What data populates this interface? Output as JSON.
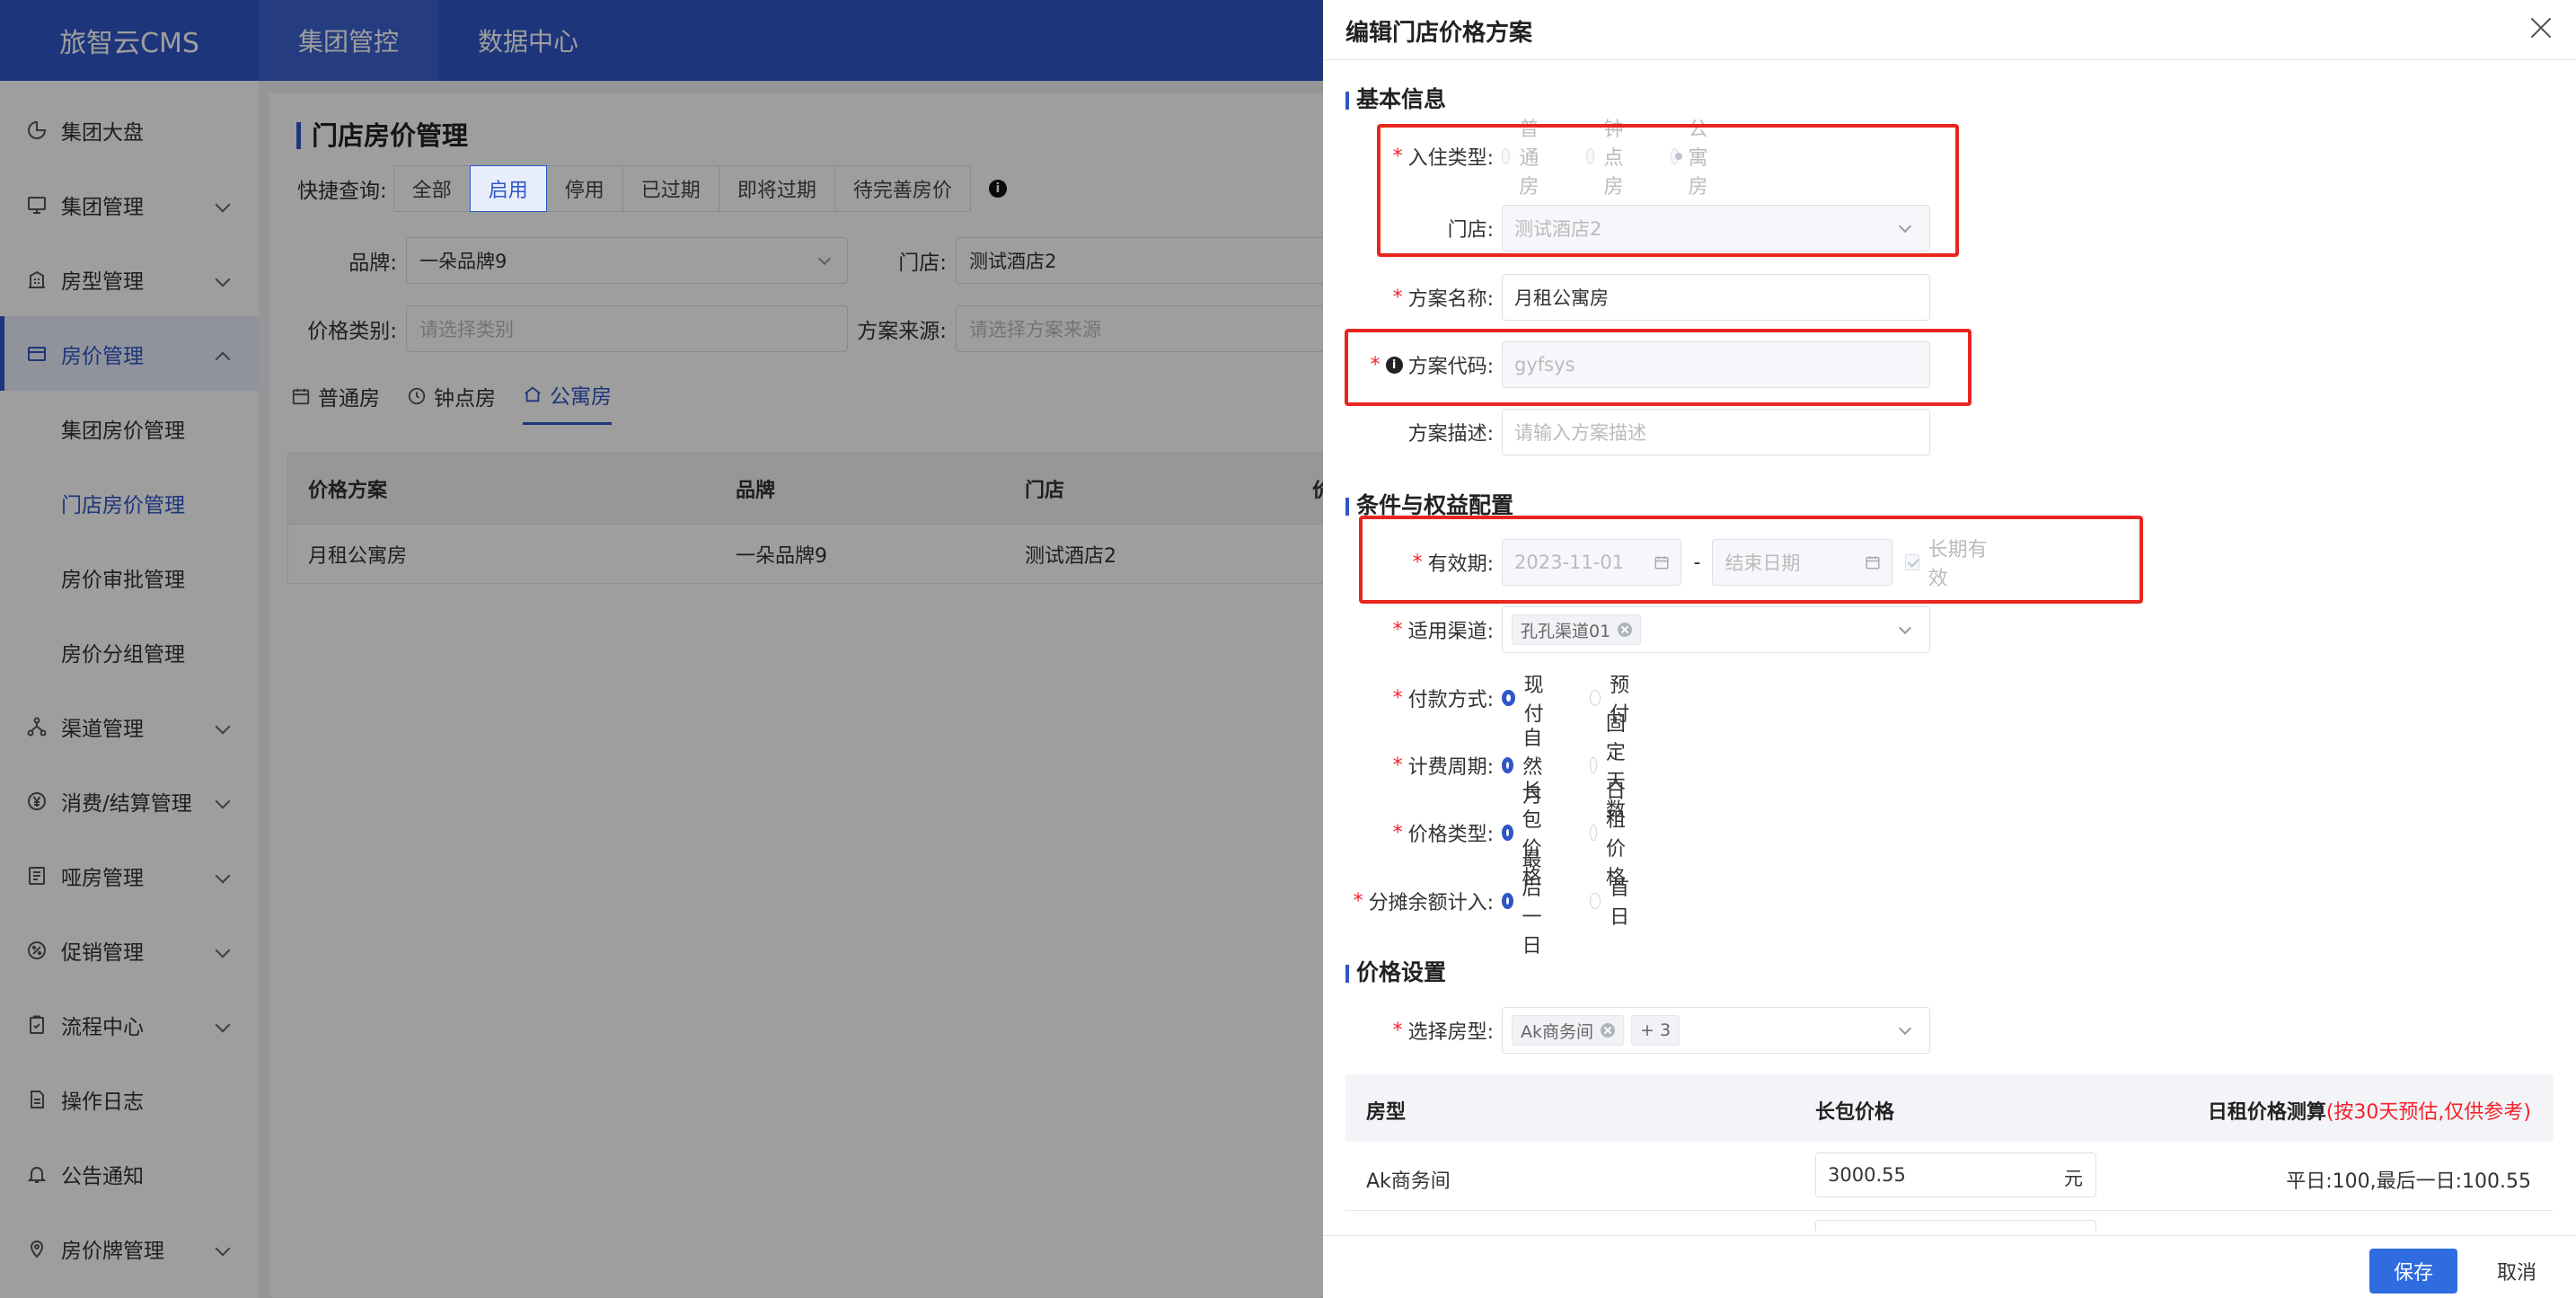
{
  "app": {
    "logo": "旅智云CMS"
  },
  "topnav": [
    "集团管控",
    "数据中心"
  ],
  "sidebar": {
    "items": [
      {
        "label": "集团大盘"
      },
      {
        "label": "集团管理"
      },
      {
        "label": "房型管理"
      },
      {
        "label": "房价管理"
      },
      {
        "label": "集团房价管理"
      },
      {
        "label": "门店房价管理"
      },
      {
        "label": "房价审批管理"
      },
      {
        "label": "房价分组管理"
      },
      {
        "label": "渠道管理"
      },
      {
        "label": "消费/结算管理"
      },
      {
        "label": "哑房管理"
      },
      {
        "label": "促销管理"
      },
      {
        "label": "流程中心"
      },
      {
        "label": "操作日志"
      },
      {
        "label": "公告通知"
      },
      {
        "label": "房价牌管理"
      }
    ]
  },
  "main": {
    "title": "门店房价管理",
    "quick_label": "快捷查询:",
    "quick": [
      "全部",
      "启用",
      "停用",
      "已过期",
      "即将过期",
      "待完善房价"
    ],
    "brand_label": "品牌:",
    "brand_value": "一朵品牌9",
    "store_label": "门店:",
    "store_value": "测试酒店2",
    "price_type_label": "价格类别:",
    "price_type_placeholder": "请选择类别",
    "source_label": "方案来源:",
    "source_placeholder": "请选择方案来源",
    "tabs": [
      "普通房",
      "钟点房",
      "公寓房"
    ],
    "table": {
      "headers": [
        "价格方案",
        "品牌",
        "门店",
        "价"
      ],
      "rows": [
        [
          "月租公寓房",
          "一朵品牌9",
          "测试酒店2"
        ]
      ]
    }
  },
  "drawer": {
    "title": "编辑门店价格方案",
    "sections": {
      "basic": "基本信息",
      "conditions": "条件与权益配置",
      "price": "价格设置"
    },
    "stay_type": {
      "label": "入住类型:",
      "options": [
        "普通房",
        "钟点房",
        "公寓房"
      ]
    },
    "store": {
      "label": "门店:",
      "value": "测试酒店2"
    },
    "plan_name": {
      "label": "方案名称:",
      "value": "月租公寓房"
    },
    "plan_code": {
      "label": "方案代码:",
      "value": "gyfsys"
    },
    "plan_desc": {
      "label": "方案描述:",
      "placeholder": "请输入方案描述"
    },
    "validity": {
      "label": "有效期:",
      "start": "2023-11-01",
      "dash": "-",
      "end_placeholder": "结束日期",
      "long_term": "长期有效"
    },
    "channel": {
      "label": "适用渠道:",
      "tag": "孔孔渠道01"
    },
    "payment": {
      "label": "付款方式:",
      "options": [
        "现付",
        "预付"
      ]
    },
    "billing": {
      "label": "计费周期:",
      "options": [
        "自然月",
        "固定天数"
      ]
    },
    "price_kind": {
      "label": "价格类型:",
      "options": [
        "长包价格",
        "日租价格"
      ]
    },
    "remainder": {
      "label": "分摊余额计入:",
      "options": [
        "最后一日",
        "首日"
      ]
    },
    "room_type": {
      "label": "选择房型:",
      "tag": "Ak商务间",
      "more": "+ 3"
    },
    "price_table": {
      "col1": "房型",
      "col2": "长包价格",
      "col3": "日租价格测算",
      "col3_note": "(按30天预估,仅供参考)",
      "row": {
        "room": "Ak商务间",
        "price": "3000.55",
        "unit": "元",
        "estimate": "平日:100,最后一日:100.55"
      }
    },
    "buttons": {
      "save": "保存",
      "cancel": "取消"
    }
  },
  "colors": {
    "primary": "#2f56c7",
    "highlight": "#e8261e",
    "required": "#f5222d"
  }
}
